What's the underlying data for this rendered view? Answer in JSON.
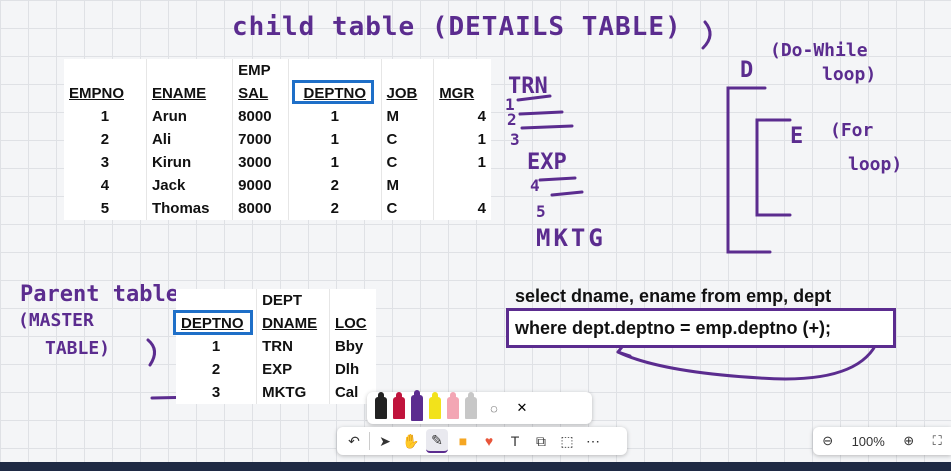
{
  "annotations": {
    "child_title": "child table (DETAILS TABLE)",
    "parent_title": "Parent table",
    "master_line1": "(MASTER",
    "master_line2": "TABLE)",
    "trn": "TRN",
    "exp": "EXP",
    "mktg": "MKTG",
    "d_label": "D",
    "do_while1": "(Do-While",
    "do_while2": "loop)",
    "e_label": "E",
    "for1": "(For",
    "for2": "loop)",
    "n1": "1",
    "n2": "2",
    "n3": "3",
    "n4": "4",
    "n5": "5"
  },
  "emp_table": {
    "header_top": "EMP",
    "headers": [
      "EMPNO",
      "ENAME",
      "SAL",
      "DEPTNO",
      "JOB",
      "MGR"
    ],
    "rows": [
      [
        "1",
        "Arun",
        "8000",
        "1",
        "M",
        "4"
      ],
      [
        "2",
        "Ali",
        "7000",
        "1",
        "C",
        "1"
      ],
      [
        "3",
        "Kirun",
        "3000",
        "1",
        "C",
        "1"
      ],
      [
        "4",
        "Jack",
        "9000",
        "2",
        "M",
        ""
      ],
      [
        "5",
        "Thomas",
        "8000",
        "2",
        "C",
        "4"
      ]
    ]
  },
  "dept_table": {
    "header_top": "DEPT",
    "headers": [
      "DEPTNO",
      "DNAME",
      "LOC"
    ],
    "rows": [
      [
        "1",
        "TRN",
        "Bby"
      ],
      [
        "2",
        "EXP",
        "Dlh"
      ],
      [
        "3",
        "MKTG",
        "Cal"
      ]
    ]
  },
  "query": {
    "line1": "select dname, ename from emp, dept",
    "line2": "where dept.deptno = emp.deptno (+);"
  },
  "zoom": {
    "level": "100%"
  },
  "colors": {
    "ink": "#5b2c8f",
    "highlight_box": "#1e6fc8"
  },
  "pens": [
    "black",
    "red",
    "purple",
    "yellow",
    "pink",
    "gray"
  ]
}
